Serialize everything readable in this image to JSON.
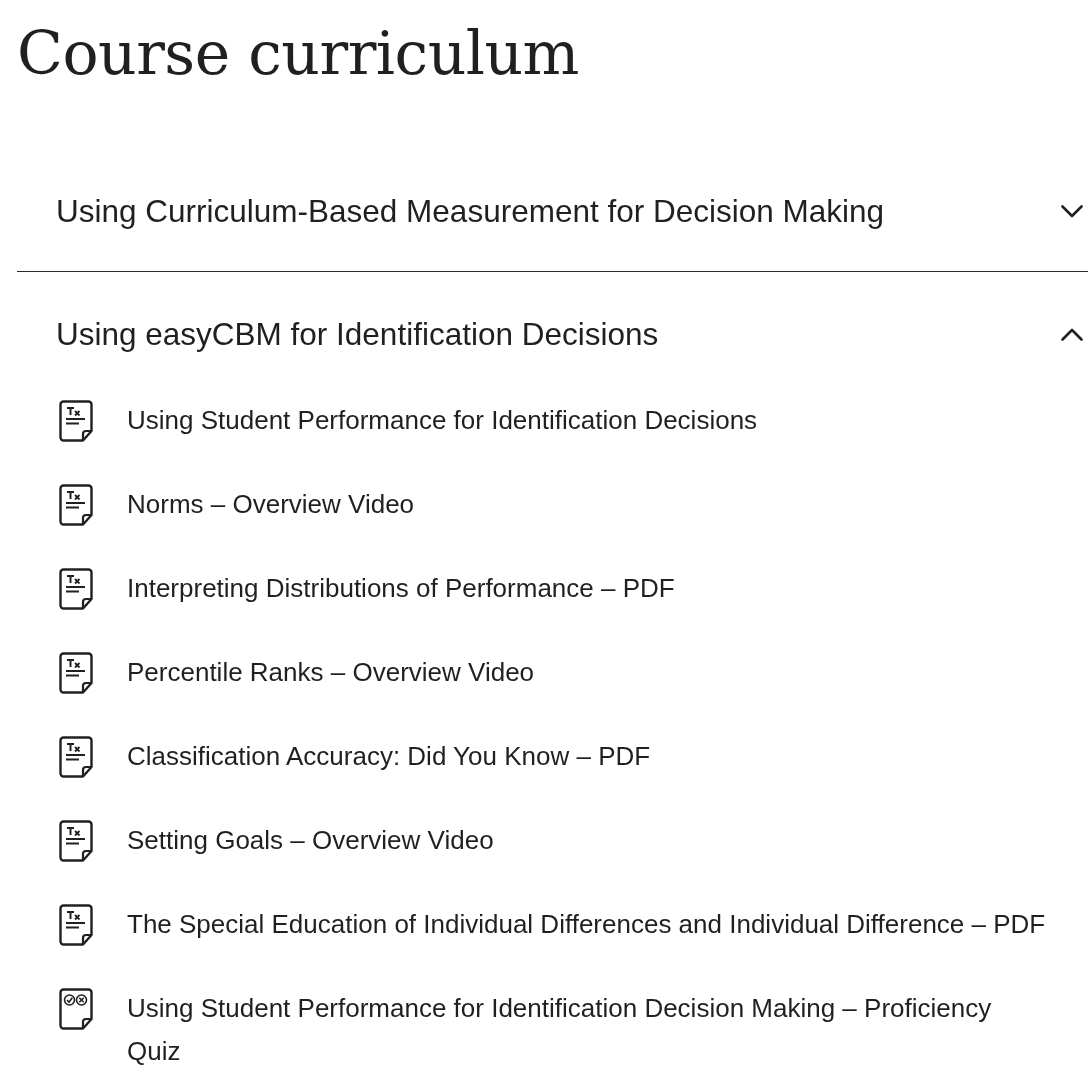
{
  "title": "Course curriculum",
  "sections": [
    {
      "title": "Using Curriculum-Based Measurement for Decision Making",
      "expanded": false
    },
    {
      "title": "Using easyCBM for Identification Decisions",
      "expanded": true,
      "lessons": [
        {
          "kind": "text",
          "title": "Using Student Performance for Identification Decisions"
        },
        {
          "kind": "text",
          "title": "Norms – Overview Video"
        },
        {
          "kind": "text",
          "title": "Interpreting Distributions of Performance – PDF"
        },
        {
          "kind": "text",
          "title": "Percentile Ranks – Overview Video"
        },
        {
          "kind": "text",
          "title": "Classification Accuracy: Did You Know – PDF"
        },
        {
          "kind": "text",
          "title": "Setting Goals – Overview Video"
        },
        {
          "kind": "text",
          "title": "The Special Education of Individual Differences and Individual Difference – PDF"
        },
        {
          "kind": "quiz",
          "title": "Using Student Performance for Identification Decision Making – Proficiency Quiz"
        }
      ]
    }
  ]
}
